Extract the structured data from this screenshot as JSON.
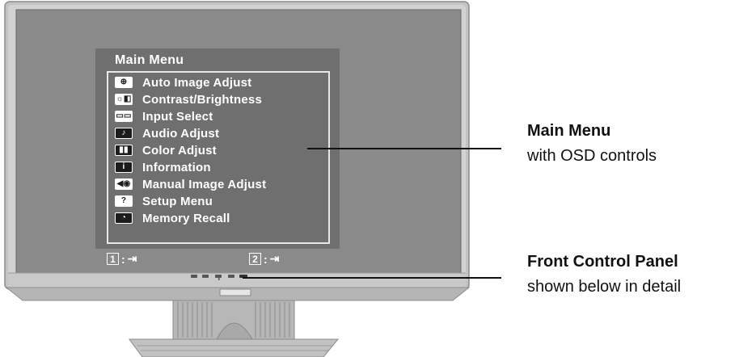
{
  "osd": {
    "title": "Main Menu",
    "items": [
      {
        "label": "Auto Image Adjust",
        "icon": "auto-adjust-icon",
        "glyph": "⊕"
      },
      {
        "label": "Contrast/Brightness",
        "icon": "contrast-brightness-icon",
        "glyph": "☼◧"
      },
      {
        "label": "Input Select",
        "icon": "input-select-icon",
        "glyph": "▭▭"
      },
      {
        "label": "Audio Adjust",
        "icon": "audio-icon",
        "glyph": "♪"
      },
      {
        "label": "Color Adjust",
        "icon": "color-icon",
        "glyph": "▮▮"
      },
      {
        "label": "Information",
        "icon": "information-icon",
        "glyph": "i"
      },
      {
        "label": "Manual Image Adjust",
        "icon": "manual-adjust-icon",
        "glyph": "◀◉"
      },
      {
        "label": "Setup Menu",
        "icon": "setup-icon",
        "glyph": "?"
      },
      {
        "label": "Memory Recall",
        "icon": "memory-recall-icon",
        "glyph": "◔"
      }
    ],
    "keys": [
      {
        "number": "1",
        "sep": ":",
        "icon": "exit-icon",
        "glyph": "⇥"
      },
      {
        "number": "2",
        "sep": ":",
        "icon": "enter-icon",
        "glyph": "⇥"
      }
    ]
  },
  "callouts": {
    "main_menu_title": "Main Menu",
    "main_menu_sub": "with OSD controls",
    "front_panel_title": "Front Control Panel",
    "front_panel_sub": "shown below in detail"
  },
  "colors": {
    "bezel": "#bcbcbc",
    "screen": "#8a8a8a",
    "osd_background": "#6f6f6f",
    "text": "#111111"
  }
}
